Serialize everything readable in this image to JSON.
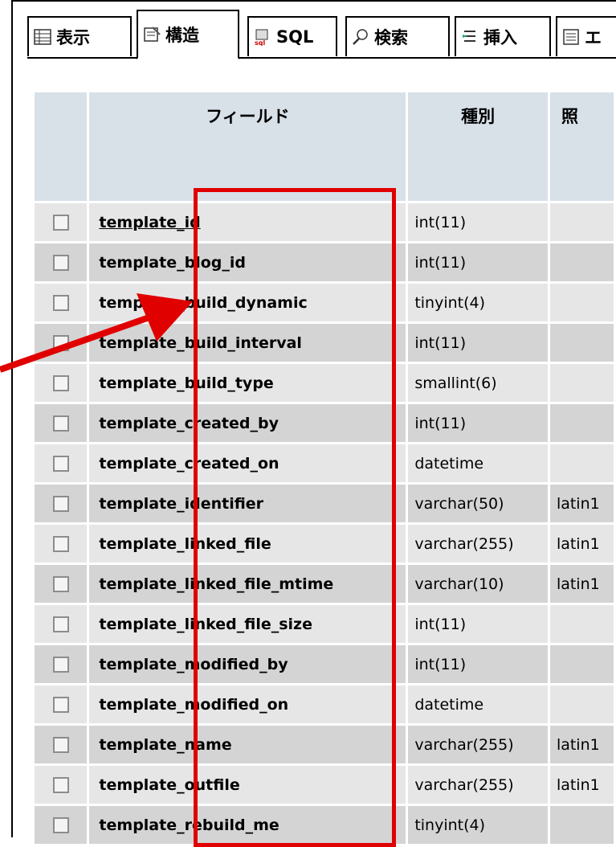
{
  "tabs": [
    {
      "label": "表示",
      "icon": "browse-icon",
      "active": false
    },
    {
      "label": "構造",
      "icon": "structure-icon",
      "active": true
    },
    {
      "label": "SQL",
      "icon": "sql-icon",
      "active": false
    },
    {
      "label": "検索",
      "icon": "search-icon",
      "active": false
    },
    {
      "label": "挿入",
      "icon": "insert-icon",
      "active": false
    },
    {
      "label": "エ",
      "icon": "export-icon",
      "active": false
    }
  ],
  "table": {
    "headers": {
      "field": "フィールド",
      "type": "種別",
      "collation": "照"
    },
    "rows": [
      {
        "field": "template_id",
        "type": "int(11)",
        "collation": ""
      },
      {
        "field": "template_blog_id",
        "type": "int(11)",
        "collation": ""
      },
      {
        "field": "template_build_dynamic",
        "type": "tinyint(4)",
        "collation": ""
      },
      {
        "field": "template_build_interval",
        "type": "int(11)",
        "collation": ""
      },
      {
        "field": "template_build_type",
        "type": "smallint(6)",
        "collation": ""
      },
      {
        "field": "template_created_by",
        "type": "int(11)",
        "collation": ""
      },
      {
        "field": "template_created_on",
        "type": "datetime",
        "collation": ""
      },
      {
        "field": "template_identifier",
        "type": "varchar(50)",
        "collation": "latin1"
      },
      {
        "field": "template_linked_file",
        "type": "varchar(255)",
        "collation": "latin1"
      },
      {
        "field": "template_linked_file_mtime",
        "type": "varchar(10)",
        "collation": "latin1"
      },
      {
        "field": "template_linked_file_size",
        "type": "int(11)",
        "collation": ""
      },
      {
        "field": "template_modified_by",
        "type": "int(11)",
        "collation": ""
      },
      {
        "field": "template_modified_on",
        "type": "datetime",
        "collation": ""
      },
      {
        "field": "template_name",
        "type": "varchar(255)",
        "collation": "latin1"
      },
      {
        "field": "template_outfile",
        "type": "varchar(255)",
        "collation": "latin1"
      },
      {
        "field": "template_rebuild_me",
        "type": "tinyint(4)",
        "collation": ""
      }
    ]
  },
  "colors": {
    "header_bg": "#d8e0e8",
    "row_odd": "#e6e6e6",
    "row_even": "#d4d4d4",
    "annotation": "#e00000"
  }
}
